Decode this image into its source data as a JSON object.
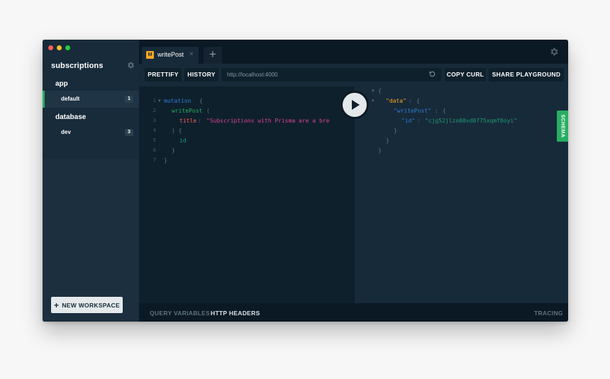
{
  "sidebar": {
    "project_title": "subscriptions",
    "sections": [
      {
        "label": "app",
        "envs": [
          {
            "name": "default",
            "count": "1"
          }
        ]
      },
      {
        "label": "database",
        "envs": [
          {
            "name": "dev",
            "count": "3"
          }
        ]
      }
    ],
    "new_workspace_label": "NEW WORKSPACE"
  },
  "tabs": [
    {
      "badge": "M",
      "name": "writePost",
      "close": "×"
    }
  ],
  "toolbar": {
    "prettify_label": "PRETTIFY",
    "history_label": "HISTORY",
    "url_value": "http://localhost:4000",
    "copy_curl_label": "COPY CURL",
    "share_label": "SHARE PLAYGROUND"
  },
  "editor": {
    "line_numbers": [
      "1",
      "2",
      "3",
      "4",
      "5",
      "6",
      "7"
    ],
    "mutation_kw": "mutation",
    "open_brace": "{",
    "fn_name": "writePost",
    "paren_open": "(",
    "arg_name": "title",
    "colon": ":",
    "arg_value": "\"Subscriptions with Prisma are a bre",
    "close_paren_brace": ") {",
    "field": "id",
    "close_brace": "}"
  },
  "result": {
    "open": "{",
    "data_key": "\"data\"",
    "write_key": "\"writePost\"",
    "id_key": "\"id\"",
    "id_value": "\"cjg52jlzo00vd0775xqmf8oyi\"",
    "colon": ":",
    "brace_open": "{",
    "brace_close": "}"
  },
  "schema_label": "SCHEMA",
  "bottom": {
    "query_vars_label": "QUERY VARIABLES",
    "http_headers_label": "HTTP HEADERS",
    "tracing_label": "TRACING"
  },
  "colors": {
    "accent_green": "#27ae60",
    "mutation_badge": "#f5a623",
    "background": "#0f202d"
  }
}
